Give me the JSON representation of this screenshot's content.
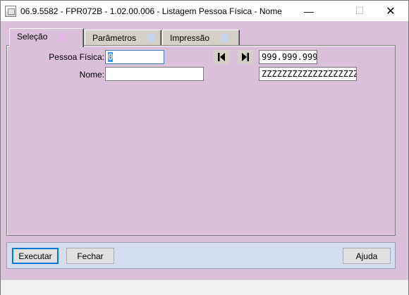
{
  "window": {
    "title": "06.9.5582 - FPR072B - 1.02.00.006 - Listagem Pessoa Física - Nome",
    "min_glyph": "—",
    "max_glyph": "☐",
    "close_glyph": "✕"
  },
  "tabs": [
    {
      "label": "Seleção",
      "selected": true
    },
    {
      "label": "Parâmetros",
      "selected": false
    },
    {
      "label": "Impressão",
      "selected": false
    }
  ],
  "form": {
    "pessoa_fisica_label": "Pessoa Física:",
    "pessoa_fisica_from": "0",
    "pessoa_fisica_to": "999.999.999",
    "nome_label": "Nome:",
    "nome_from": "",
    "nome_to": "ZZZZZZZZZZZZZZZZZZZZZZZZZZZZZZ"
  },
  "buttons": {
    "executar": "Executar",
    "fechar": "Fechar",
    "ajuda": "Ajuda"
  },
  "colors": {
    "panel_bg": "#d9c1d9",
    "bottom_bar_bg": "#d3ddee",
    "selection": "#3399ff"
  }
}
